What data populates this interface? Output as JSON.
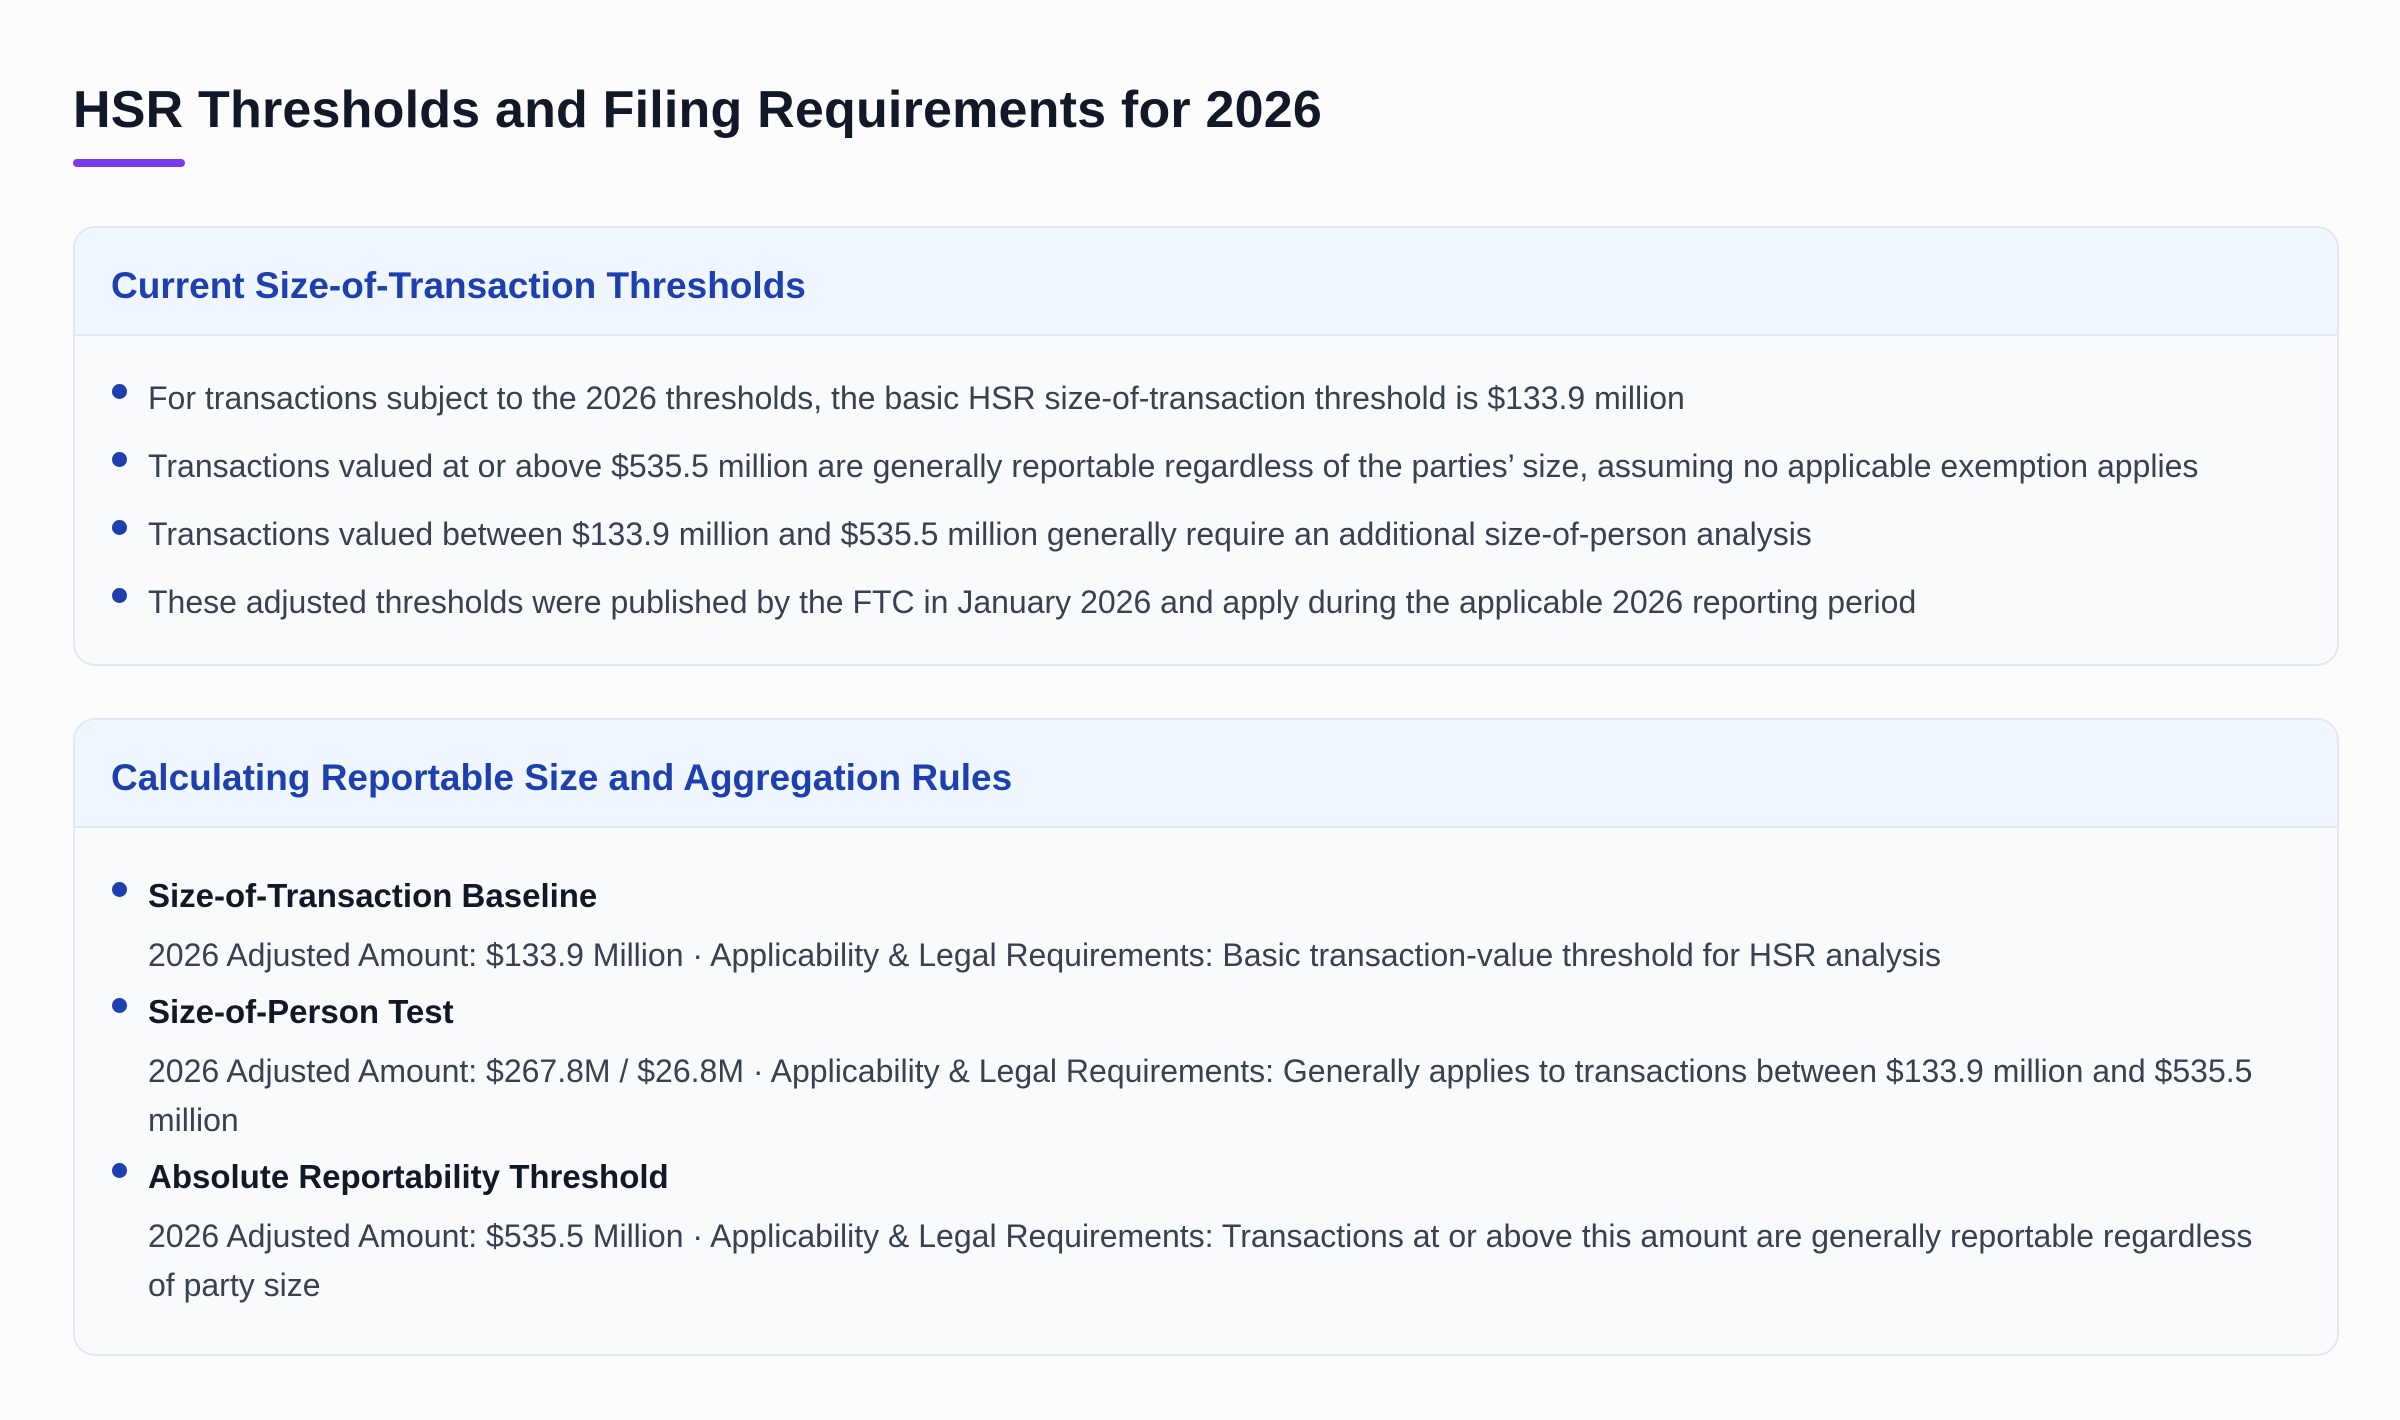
{
  "page": {
    "title": "HSR Thresholds and Filing Requirements for 2026"
  },
  "section_thresholds": {
    "heading": "Current Size-of-Transaction Thresholds",
    "items": [
      "For transactions subject to the 2026 thresholds, the basic HSR size-of-transaction threshold is $133.9 million",
      "Transactions valued at or above $535.5 million are generally reportable regardless of the parties’ size, assuming no applicable exemption applies",
      "Transactions valued between $133.9 million and $535.5 million generally require an additional size-of-person analysis",
      "These adjusted thresholds were published by the FTC in January 2026 and apply during the applicable 2026 reporting period"
    ]
  },
  "section_rules": {
    "heading": "Calculating Reportable Size and Aggregation Rules",
    "items": [
      {
        "name": "Size-of-Transaction Baseline",
        "description": "2026 Adjusted Amount: $133.9 Million · Applicability & Legal Requirements: Basic transaction-value threshold for HSR analysis"
      },
      {
        "name": "Size-of-Person Test",
        "description": "2026 Adjusted Amount: $267.8M / $26.8M · Applicability & Legal Requirements: Generally applies to transactions between $133.9 million and $535.5 million"
      },
      {
        "name": "Absolute Reportability Threshold",
        "description": "2026 Adjusted Amount: $535.5 Million · Applicability & Legal Requirements: Transactions at or above this amount are generally reportable regardless of party size"
      }
    ]
  },
  "colors": {
    "accent_underline": "#7c3aed",
    "heading_blue": "#1e40af",
    "header_background": "#eff6ff",
    "card_background": "#f8fafc"
  }
}
